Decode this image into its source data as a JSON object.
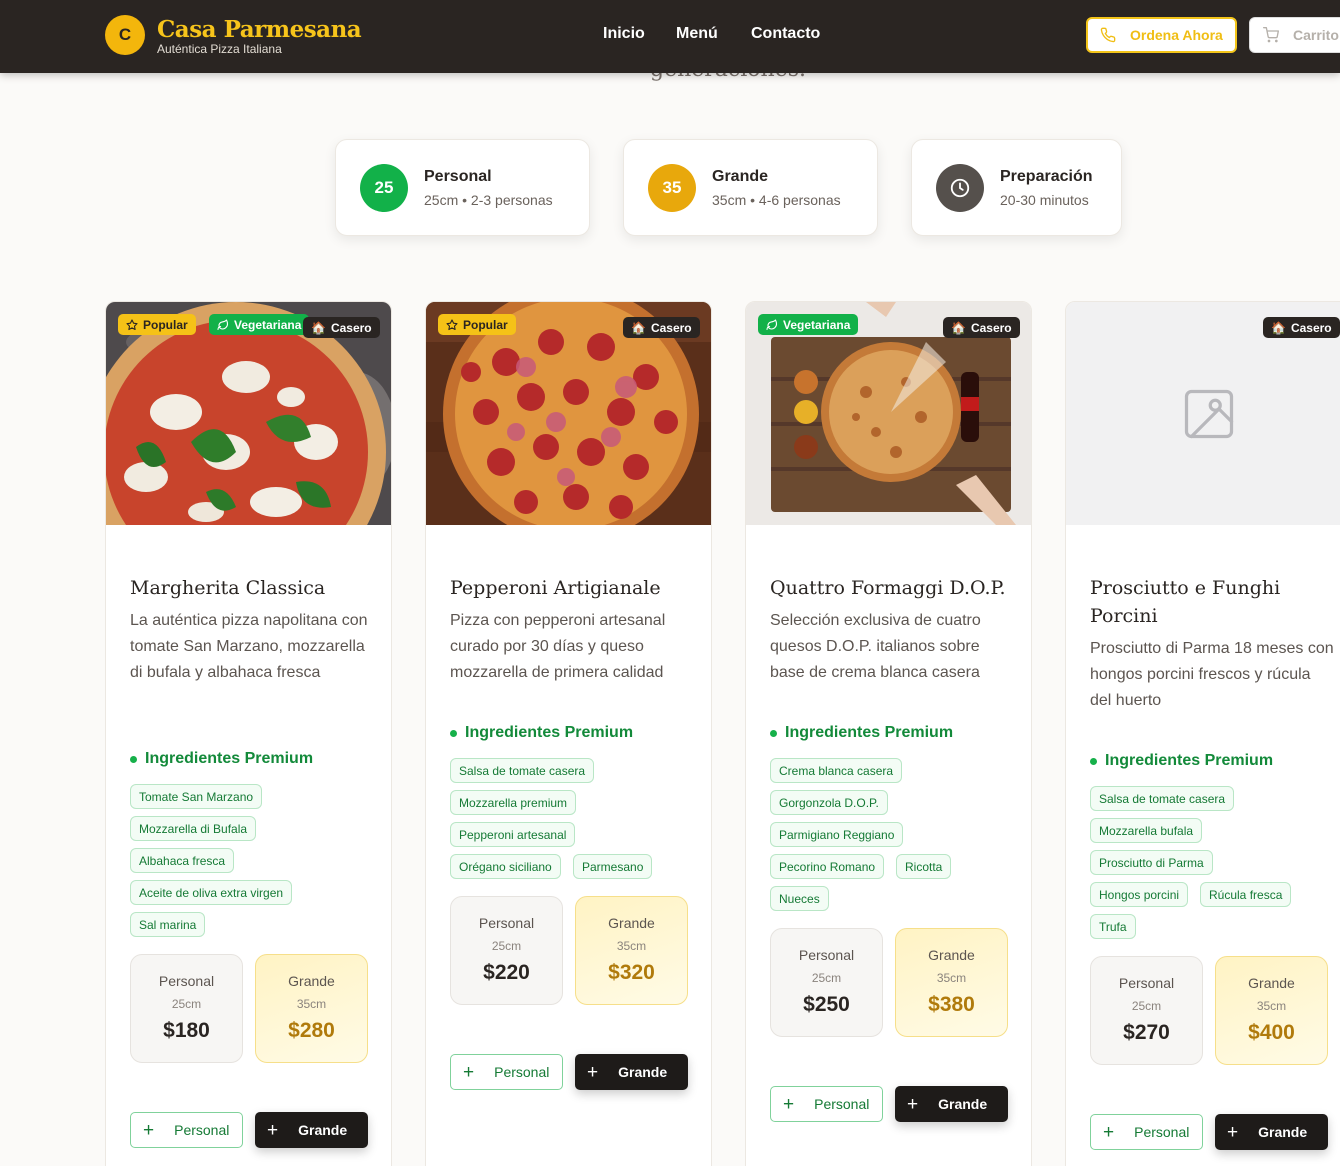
{
  "header": {
    "logo_letter": "C",
    "brand": "Casa Parmesana",
    "tagline": "Auténtica Pizza Italiana",
    "nav": [
      "Inicio",
      "Menú",
      "Contacto"
    ],
    "order_label": "Ordena Ahora",
    "cart_label": "Carrito"
  },
  "hero_fragment": "generaciones.",
  "info": [
    {
      "badge": "25",
      "title": "Personal",
      "sub": "25cm • 2-3 personas",
      "color": "#12b149"
    },
    {
      "badge": "35",
      "title": "Grande",
      "sub": "35cm • 4-6 personas",
      "color": "#e8a80c"
    },
    {
      "badge": "",
      "title": "Preparación",
      "sub": "20-30 minutos",
      "color": "#55504c"
    }
  ],
  "ingredients_heading": "Ingredientes Premium",
  "badges": {
    "popular": "Popular",
    "veg": "Vegetariana",
    "casero": "Casero"
  },
  "pizzas": [
    {
      "title": "Margherita Classica",
      "desc": "La auténtica pizza napolitana con tomate San Marzano, mozzarella di bufala y albahaca fresca",
      "ingredients": [
        "Tomate San Marzano",
        "Mozzarella di Bufala",
        "Albahaca fresca",
        "Aceite de oliva extra virgen",
        "Sal marina"
      ],
      "personal": {
        "label": "Personal",
        "size": "25cm",
        "price": "$180"
      },
      "grande": {
        "label": "Grande",
        "size": "35cm",
        "price": "$280"
      },
      "add_personal": "Personal",
      "add_grande": "Grande"
    },
    {
      "title": "Pepperoni Artigianale",
      "desc": "Pizza con pepperoni artesanal curado por 30 días y queso mozzarella de primera calidad",
      "ingredients": [
        "Salsa de tomate casera",
        "Mozzarella premium",
        "Pepperoni artesanal",
        "Orégano siciliano",
        "Parmesano"
      ],
      "personal": {
        "label": "Personal",
        "size": "25cm",
        "price": "$220"
      },
      "grande": {
        "label": "Grande",
        "size": "35cm",
        "price": "$320"
      },
      "add_personal": "Personal",
      "add_grande": "Grande"
    },
    {
      "title": "Quattro Formaggi D.O.P.",
      "desc": "Selección exclusiva de cuatro quesos D.O.P. italianos sobre base de crema blanca casera",
      "ingredients": [
        "Crema blanca casera",
        "Gorgonzola D.O.P.",
        "Parmigiano Reggiano",
        "Pecorino Romano",
        "Ricotta",
        "Nueces"
      ],
      "personal": {
        "label": "Personal",
        "size": "25cm",
        "price": "$250"
      },
      "grande": {
        "label": "Grande",
        "size": "35cm",
        "price": "$380"
      },
      "add_personal": "Personal",
      "add_grande": "Grande"
    },
    {
      "title": "Prosciutto e Funghi Porcini",
      "desc": "Prosciutto di Parma 18 meses con hongos porcini frescos y rúcula del huerto",
      "ingredients": [
        "Salsa de tomate casera",
        "Mozzarella bufala",
        "Prosciutto di Parma",
        "Hongos porcini",
        "Rúcula fresca",
        "Trufa"
      ],
      "personal": {
        "label": "Personal",
        "size": "25cm",
        "price": "$270"
      },
      "grande": {
        "label": "Grande",
        "size": "35cm",
        "price": "$400"
      },
      "add_personal": "Personal",
      "add_grande": "Grande"
    }
  ]
}
